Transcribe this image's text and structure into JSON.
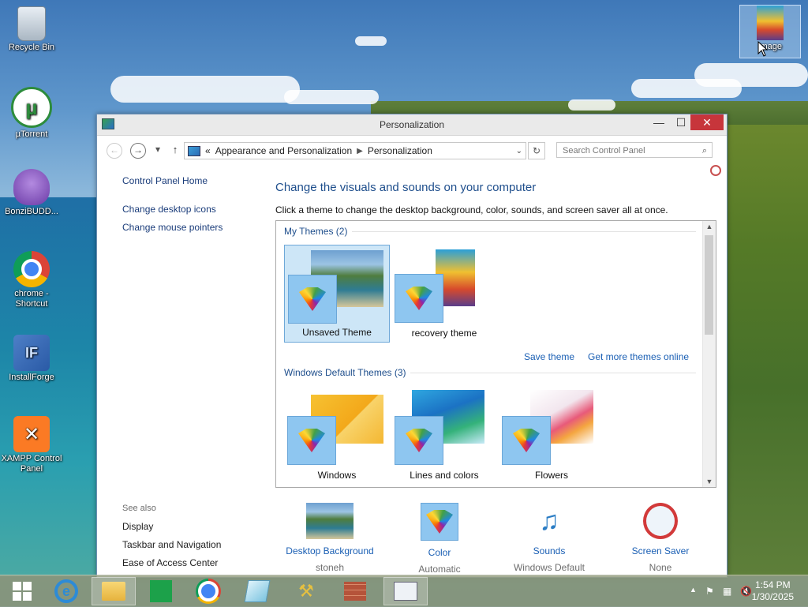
{
  "desktop": {
    "icons": [
      {
        "label": "Recycle Bin"
      },
      {
        "label": "µTorrent"
      },
      {
        "label": "BonziBUDD..."
      },
      {
        "label": "chrome - Shortcut"
      },
      {
        "label": "InstallForge"
      },
      {
        "label": "XAMPP Control Panel"
      }
    ],
    "selected_icon": {
      "label": "image"
    }
  },
  "window": {
    "title": "Personalization",
    "controls": {
      "minimize": "—",
      "maximize": "☐",
      "close": "✕"
    },
    "nav": {
      "back": "←",
      "forward": "→",
      "up": "↑",
      "recent": "▾"
    },
    "address": {
      "prefix": "«",
      "crumbs": [
        "Appearance and Personalization",
        "Personalization"
      ]
    },
    "search_placeholder": "Search Control Panel",
    "sidebar": {
      "links": [
        "Control Panel Home",
        "Change desktop icons",
        "Change mouse pointers"
      ],
      "see_also_title": "See also",
      "see_also": [
        "Display",
        "Taskbar and Navigation",
        "Ease of Access Center"
      ]
    },
    "main": {
      "title": "Change the visuals and sounds on your computer",
      "subtitle": "Click a theme to change the desktop background, color, sounds, and screen saver all at once.",
      "my_themes_title": "My Themes (2)",
      "my_themes": [
        "Unsaved Theme",
        "recovery theme"
      ],
      "save_theme": "Save theme",
      "more_themes": "Get more themes online",
      "default_themes_title": "Windows Default Themes (3)",
      "default_themes": [
        "Windows",
        "Lines and colors",
        "Flowers"
      ]
    },
    "bottom": [
      {
        "label": "Desktop Background",
        "sub": "stoneh"
      },
      {
        "label": "Color",
        "sub": "Automatic"
      },
      {
        "label": "Sounds",
        "sub": "Windows Default"
      },
      {
        "label": "Screen Saver",
        "sub": "None"
      }
    ]
  },
  "taskbar": {
    "time": "1:54 PM",
    "date": "1/30/2025"
  }
}
